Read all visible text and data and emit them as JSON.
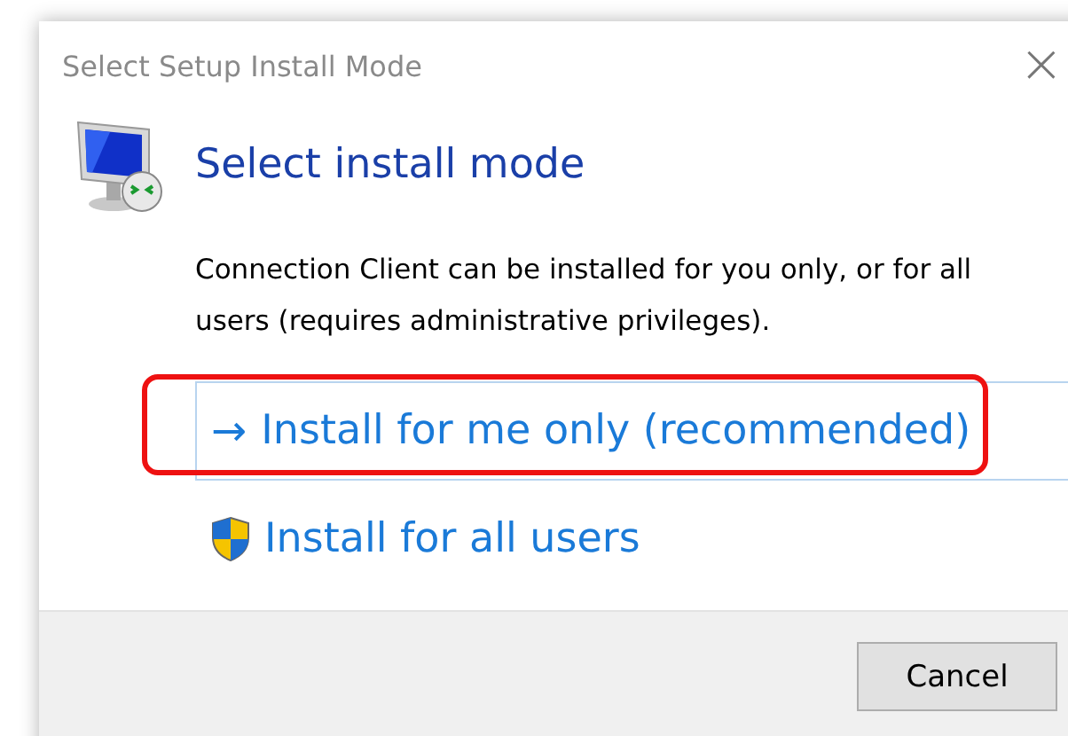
{
  "window": {
    "title": "Select Setup Install Mode",
    "close_glyph": "×"
  },
  "heading": "Select install mode",
  "description": "Connection Client can be installed for you only, or for all users (requires administrative privileges).",
  "options": [
    {
      "kind": "arrow",
      "glyph": "→",
      "label": "Install for me only (recommended)",
      "selected": true,
      "highlighted": true
    },
    {
      "kind": "shield",
      "label": "Install for all users",
      "selected": false,
      "highlighted": false
    }
  ],
  "buttons": [
    "Cancel"
  ]
}
